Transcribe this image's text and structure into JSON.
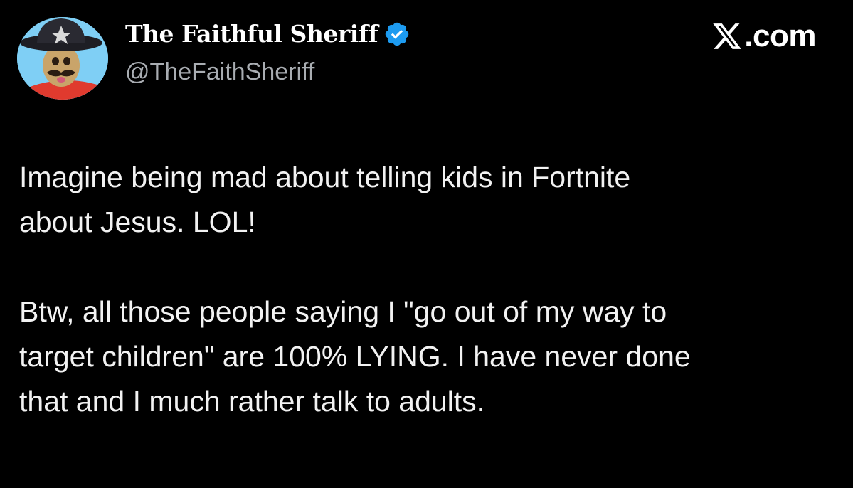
{
  "author": {
    "display_name": "The Faithful Sheriff",
    "handle": "@TheFaithSheriff",
    "verified": true,
    "avatar_icon": "sheriff-peanut-avatar"
  },
  "brand": {
    "icon": "x-logo-icon",
    "label": ".com"
  },
  "tweet": {
    "paragraphs": [
      "Imagine being mad about telling kids in Fortnite\nabout Jesus. LOL!",
      "Btw, all those people saying I \"go out of my way to\ntarget children\" are 100% LYING. I have never done\nthat and I much rather talk to adults."
    ]
  },
  "colors": {
    "background": "#000000",
    "text": "#ffffff",
    "handle": "#a9adb2",
    "verified_badge": "#1d9bf0",
    "avatar_ring": "#6ec6f2"
  }
}
